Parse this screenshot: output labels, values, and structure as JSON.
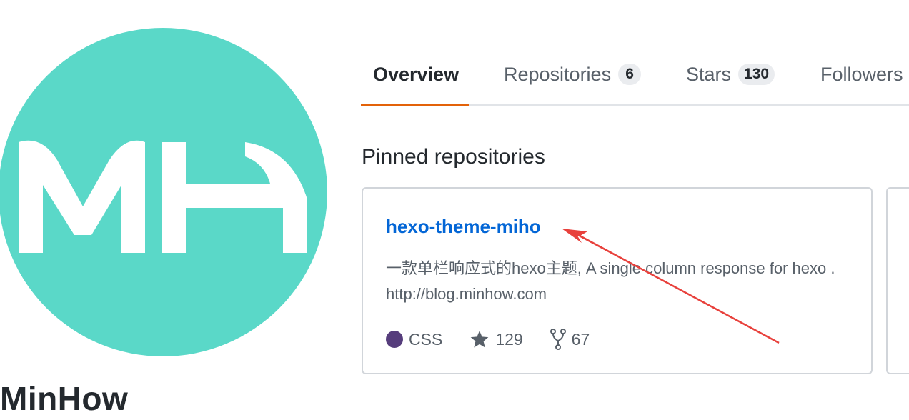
{
  "profile": {
    "avatar_letters": "MH",
    "avatar_color": "#5ad8c8",
    "username": "MinHow"
  },
  "tabs": [
    {
      "label": "Overview",
      "count": null,
      "active": true
    },
    {
      "label": "Repositories",
      "count": "6",
      "active": false
    },
    {
      "label": "Stars",
      "count": "130",
      "active": false
    },
    {
      "label": "Followers",
      "count": null,
      "active": false
    }
  ],
  "pinned": {
    "heading": "Pinned repositories",
    "repos": [
      {
        "name": "hexo-theme-miho",
        "description": "一款单栏响应式的hexo主题, A single column response for hexo . http://blog.minhow.com",
        "language": "CSS",
        "language_color": "#563d7c",
        "stars": "129",
        "forks": "67"
      }
    ]
  },
  "colors": {
    "link": "#0366d6",
    "active_tab_underline": "#e36209",
    "annotation_arrow": "#e8413c"
  }
}
